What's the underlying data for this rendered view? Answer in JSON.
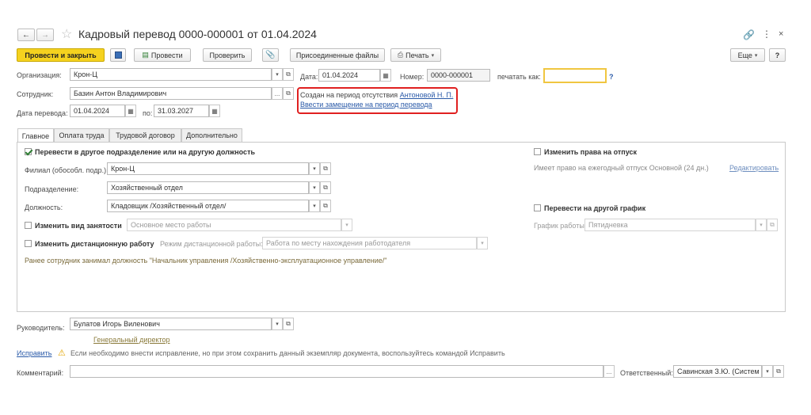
{
  "window": {
    "title": "Кадровый перевод 0000-000001 от 01.04.2024",
    "link_icon": "link-icon",
    "more_icon": "more-icon",
    "close_icon": "close-icon"
  },
  "toolbar": {
    "post_and_close": "Провести и закрыть",
    "post": "Провести",
    "check": "Проверить",
    "attached_files": "Присоединенные файлы",
    "print": "Печать",
    "more": "Еще",
    "help": "?"
  },
  "header": {
    "organization_label": "Организация:",
    "organization_value": "Крон-Ц",
    "employee_label": "Сотрудник:",
    "employee_value": "Базин Антон Владимирович",
    "transfer_date_label": "Дата перевода:",
    "transfer_date_value": "01.04.2024",
    "to_label": "по:",
    "to_value": "31.03.2027",
    "date_label": "Дата:",
    "date_value": "01.04.2024",
    "number_label": "Номер:",
    "number_value": "0000-000001",
    "print_as_label": "печатать как:",
    "print_as_value": "",
    "help_q": "?"
  },
  "notice": {
    "created_text": "Создан на период отсутствия",
    "created_link": "Антоновой Н. П.",
    "substitution_link": "Ввести замещение на период перевода"
  },
  "tabs": [
    {
      "label": "Главное"
    },
    {
      "label": "Оплата труда"
    },
    {
      "label": "Трудовой договор"
    },
    {
      "label": "Дополнительно"
    }
  ],
  "main": {
    "transfer_checkbox_label": "Перевести в другое подразделение или на другую должность",
    "branch_label": "Филиал (обособл. подр.):",
    "branch_value": "Крон-Ц",
    "department_label": "Подразделение:",
    "department_value": "Хозяйственный отдел",
    "position_label": "Должность:",
    "position_value": "Кладовщик /Хозяйственный отдел/",
    "employment_type_label": "Изменить вид занятости",
    "employment_type_value": "Основное место работы",
    "remote_label": "Изменить дистанционную работу",
    "remote_mode_label": "Режим дистанционной работы:",
    "remote_mode_value": "Работа по месту нахождения работодателя",
    "previous_note": "Ранее сотрудник занимал должность \"Начальник управления /Хозяйственно-эксплуатационное управление/\"",
    "vacation_rights_label": "Изменить права на отпуск",
    "vacation_info": "Имеет право на ежегодный отпуск Основной (24 дн.)",
    "edit_link": "Редактировать",
    "schedule_checkbox_label": "Перевести на другой график",
    "schedule_label": "График работы:",
    "schedule_value": "Пятидневка"
  },
  "footer": {
    "manager_label": "Руководитель:",
    "manager_value": "Булатов Игорь Виленович",
    "manager_position": "Генеральный директор",
    "fix_link": "Исправить",
    "fix_note": "Если необходимо внести исправление, но при этом сохранить данный экземпляр документа, воспользуйтесь командой Исправить",
    "comment_label": "Комментарий:",
    "comment_value": "",
    "responsible_label": "Ответственный:",
    "responsible_value": "Савинская З.Ю. (Систем"
  },
  "colors": {
    "primary_button": "#f5d21f",
    "highlight_border": "#e02020",
    "link": "#2a5aa8",
    "checkbox_check": "#2e7d32"
  }
}
